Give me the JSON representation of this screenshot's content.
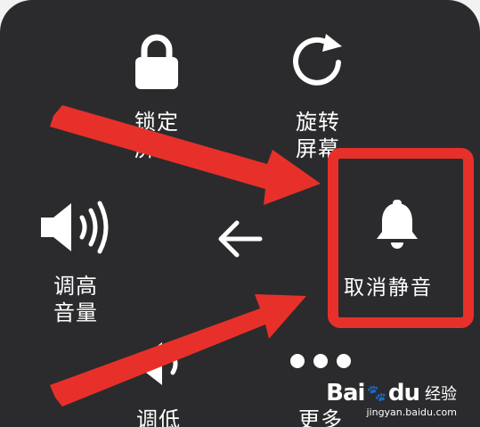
{
  "menu": {
    "lock_screen": {
      "label": "锁定屏幕",
      "icon": "lock-icon"
    },
    "rotate_screen": {
      "label": "旋转屏幕",
      "icon": "rotate-icon"
    },
    "volume_up": {
      "label": "调高音量",
      "icon": "volume-up-icon"
    },
    "back": {
      "icon": "arrow-left-icon"
    },
    "unmute": {
      "label": "取消静音",
      "icon": "bell-icon"
    },
    "volume_down": {
      "label": "调低",
      "icon": "volume-down-icon"
    },
    "more": {
      "label": "更多",
      "icon": "more-dots-icon"
    }
  },
  "watermark": {
    "brand": "Bai",
    "brand_suffix": "du",
    "experience": "经验",
    "url": "jingyan.baidu.com"
  },
  "colors": {
    "panel_bg": "#2b2b2d",
    "annotation_red": "#e8302a",
    "text": "#ffffff"
  }
}
